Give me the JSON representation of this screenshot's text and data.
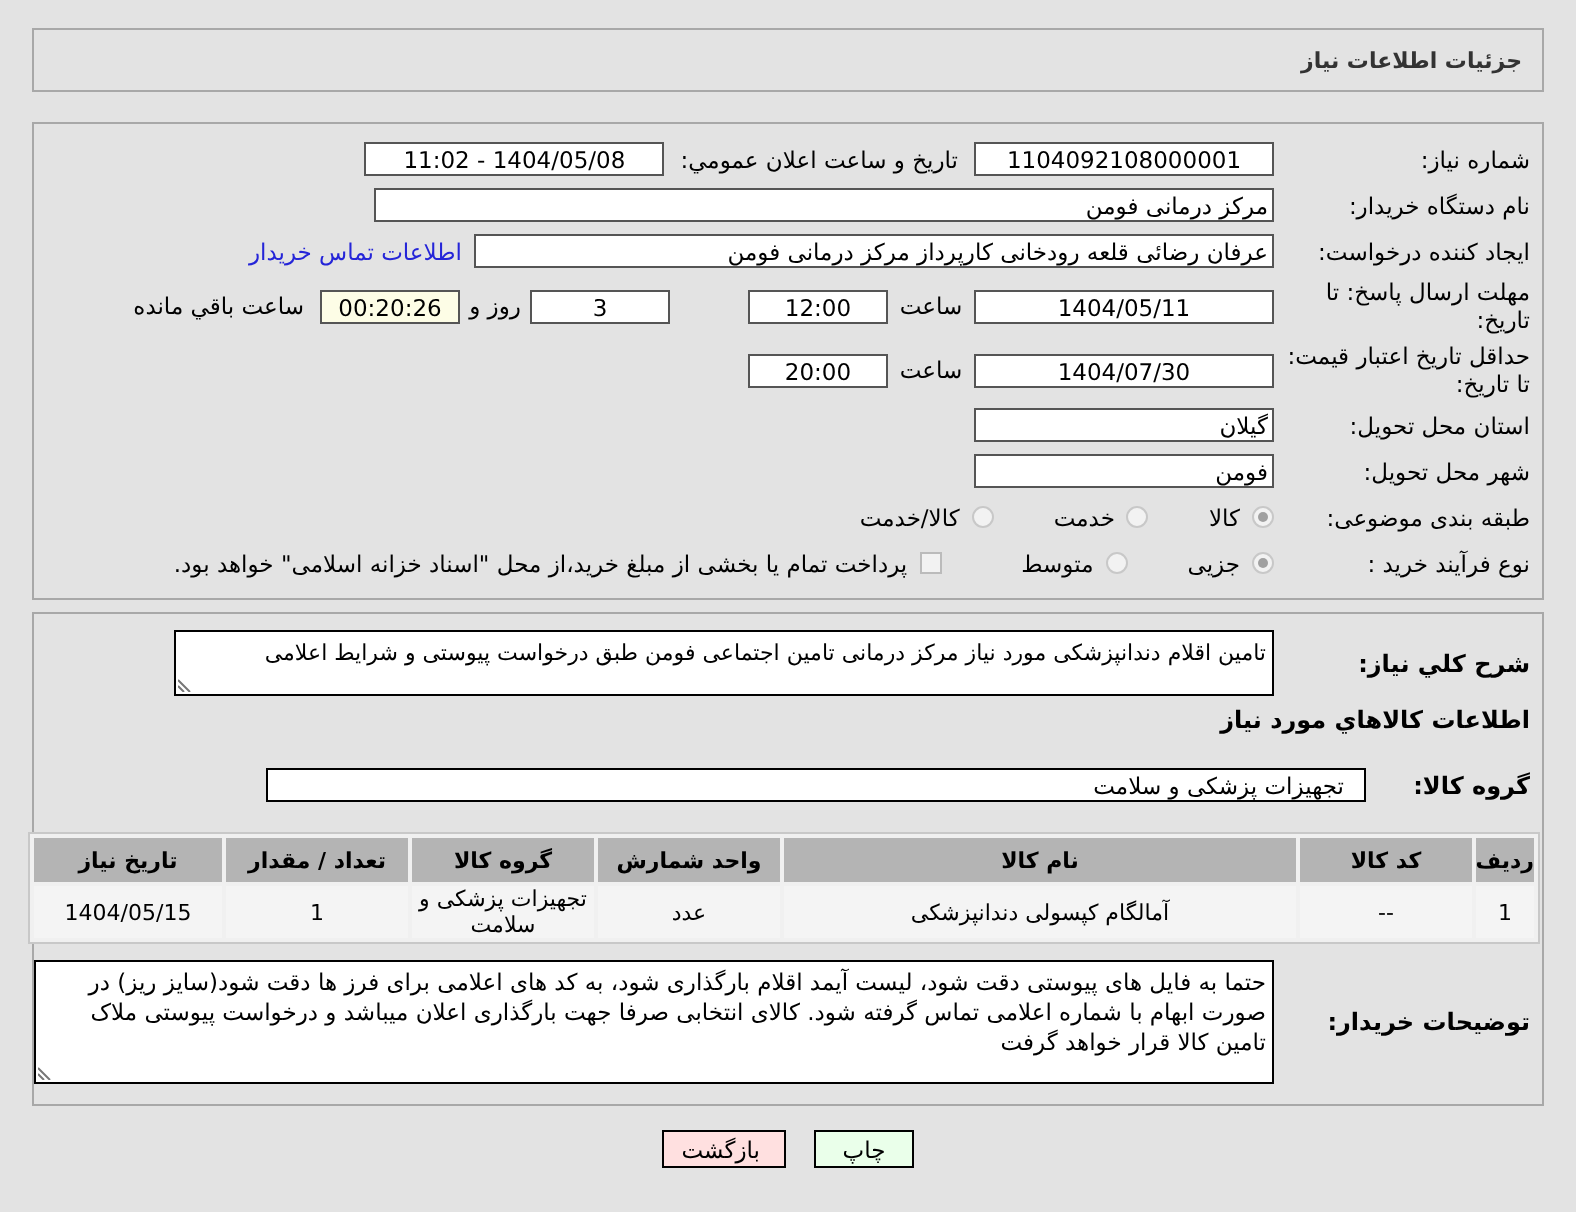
{
  "header": {
    "title": "جزئیات اطلاعات نیاز"
  },
  "need_number": {
    "label": "شماره نیاز:",
    "value": "1104092108000001"
  },
  "announce": {
    "label": "تاریخ و ساعت اعلان عمومي:",
    "value": "1404/05/08 - 11:02"
  },
  "buyer_org": {
    "label": "نام دستگاه خریدار:",
    "value": "مرکز درمانی فومن"
  },
  "requester": {
    "label": "ایجاد کننده درخواست:",
    "value": "عرفان رضائی قلعه رودخانی کارپرداز مرکز درمانی فومن",
    "link": "اطلاعات تماس خریدار"
  },
  "reply_deadline": {
    "label": "مهلت ارسال پاسخ: تا تاریخ:",
    "date": "1404/05/11",
    "time_label": "ساعت",
    "time": "12:00",
    "days": "3",
    "days_label": "روز و",
    "remaining": "00:20:26",
    "remaining_label": "ساعت باقي مانده"
  },
  "price_validity": {
    "label": "حداقل تاریخ اعتبار قیمت: تا تاریخ:",
    "date": "1404/07/30",
    "time_label": "ساعت",
    "time": "20:00"
  },
  "province": {
    "label": "استان محل تحویل:",
    "value": "گیلان"
  },
  "city": {
    "label": "شهر محل تحویل:",
    "value": "فومن"
  },
  "category": {
    "label": "طبقه بندی موضوعی:",
    "options": [
      {
        "label": "کالا",
        "selected": true
      },
      {
        "label": "خدمت",
        "selected": false
      },
      {
        "label": "کالا/خدمت",
        "selected": false
      }
    ]
  },
  "process": {
    "label": "نوع فرآیند خرید :",
    "options": [
      {
        "label": "جزیی",
        "selected": true
      },
      {
        "label": "متوسط",
        "selected": false
      }
    ],
    "treasury": {
      "label": "پرداخت تمام یا بخشی از مبلغ خرید،از محل \"اسناد خزانه اسلامی\" خواهد بود.",
      "checked": false
    }
  },
  "description": {
    "label": "شرح کلي نیاز:",
    "value": "تامین اقلام دندانپزشکی مورد نیاز مرکز درمانی تامین اجتماعی فومن طبق درخواست پیوستی و شرایط اعلامی"
  },
  "goods_title": "اطلاعات کالاهاي مورد نیاز",
  "goods_group": {
    "label": "گروه کالا:",
    "value": "تجهیزات پزشکی و سلامت"
  },
  "table": {
    "columns": [
      "ردیف",
      "کد کالا",
      "نام کالا",
      "واحد شمارش",
      "گروه کالا",
      "تعداد / مقدار",
      "تاریخ نیاز"
    ],
    "rows": [
      [
        "1",
        "--",
        "آمالگام کپسولی دندانپزشکی",
        "عدد",
        "تجهیزات پزشکی و سلامت",
        "1",
        "1404/05/15"
      ]
    ]
  },
  "buyer_notes": {
    "label": "توضیحات خریدار:",
    "value": "حتما به فایل های پیوستی دقت شود، لیست آیمد اقلام بارگذاری شود، به کد های اعلامی برای فرز ها دقت شود(سایز ریز) در صورت ابهام با شماره اعلامی تماس گرفته شود. کالای انتخابی صرفا جهت بارگذاری اعلان میباشد و درخواست پیوستی ملاک تامین کالا قرار خواهد گرفت"
  },
  "buttons": [
    {
      "label": "چاپ",
      "kind": "print"
    },
    {
      "label": "بازگشت",
      "kind": "back"
    }
  ]
}
